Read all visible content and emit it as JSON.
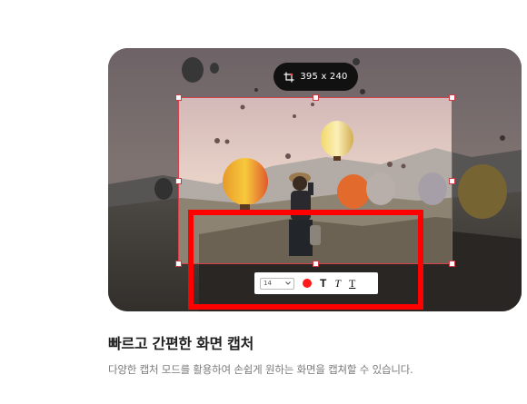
{
  "capture": {
    "dimension_label": "395 x 240",
    "dimension_icon": "crop-icon"
  },
  "toolbar": {
    "font_size_value": "14",
    "color": "#ff1a1a",
    "bold_label": "T",
    "italic_label": "T",
    "underline_label": "T"
  },
  "heading": "빠르고 간편한 화면 캡처",
  "description": "다양한 캡처 모드를 활용하여 손쉽게 원하는 화면을 캡쳐할 수 있습니다.",
  "colors": {
    "selection_border": "#d8404a",
    "highlight_box": "#ff0000"
  }
}
